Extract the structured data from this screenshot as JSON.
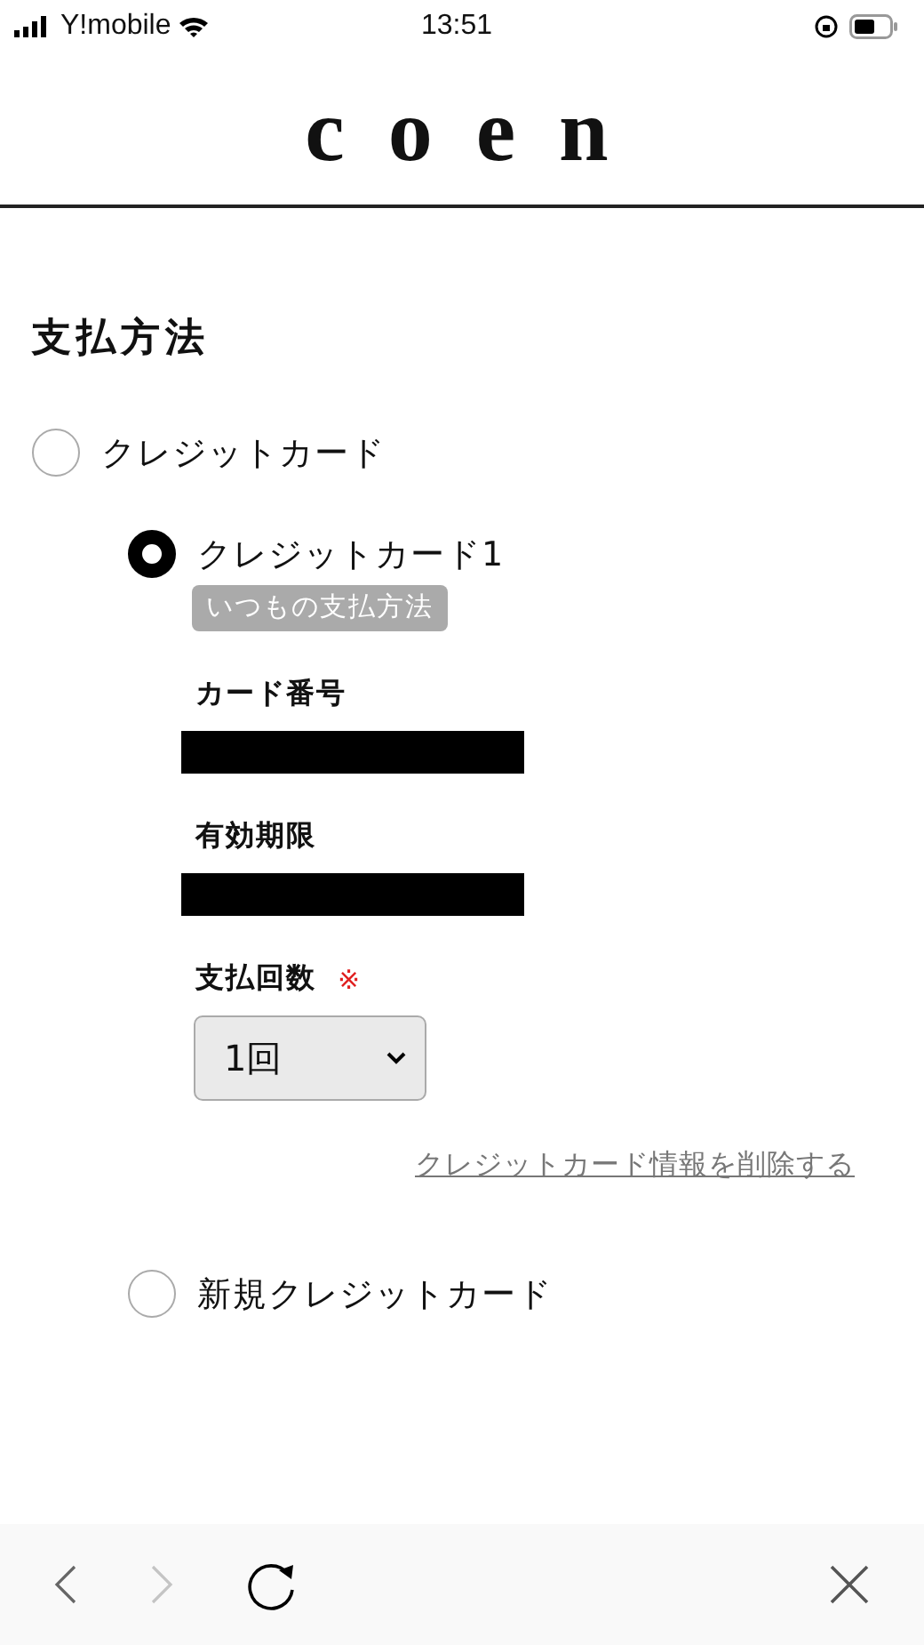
{
  "status_bar": {
    "carrier": "Y!mobile",
    "time": "13:51"
  },
  "logo": "c o e n",
  "title": "支払方法",
  "methods": [
    {
      "label": "クレジットカード",
      "selected": false,
      "children": [
        {
          "label": "クレジットカード1",
          "selected": true,
          "badge": "いつもの支払方法",
          "fields": [
            {
              "kind": "redacted",
              "label": "カード番号"
            },
            {
              "kind": "redacted",
              "label": "有効期限"
            },
            {
              "kind": "select",
              "label": "支払回数",
              "required_mark": "※",
              "value": "1回"
            }
          ],
          "link": "クレジットカード情報を削除する"
        },
        {
          "label": "新規クレジットカード",
          "selected": false
        }
      ]
    }
  ],
  "toolbar": {
    "back_disabled": false,
    "forward_disabled": true
  }
}
